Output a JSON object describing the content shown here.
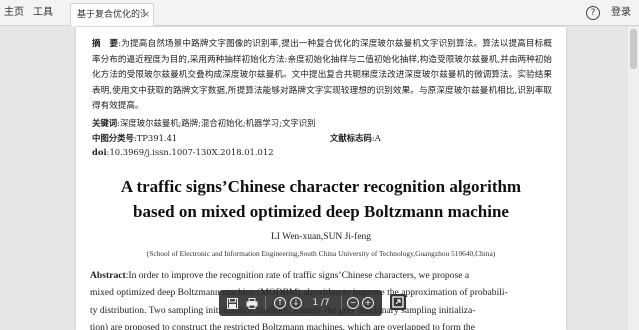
{
  "topbar": {
    "home": "主页",
    "tools": "工具",
    "doc_tab_title": "基于复合优化的深...",
    "tab_close": "×",
    "help": "?",
    "login": "登录"
  },
  "paper": {
    "abstract_cn_label": "摘　要",
    "abstract_cn_text": ":为提高自然场景中路牌文字图像的识别率,提出一种复合优化的深度玻尔兹曼机文字识别算法。算法以提高目标概率分布的逼近程度为目的,采用两种抽样初始化方法:亲度初始化抽样与二值初始化抽样,构造受限玻尔兹曼机,并由两种初始化方法的受限玻尔兹曼机交叠构成深度玻尔兹曼机。文中提出复合共轭梯度法改进深度玻尔兹曼机的微调算法。实验结果表明,使用文中获取的路牌文字数据,所提算法能够对路牌文字实现较理想的识别效果。与原深度玻尔兹曼机相比,识别率取得有效提高。",
    "keywords_label": "关键词",
    "keywords": ":深度玻尔兹曼机;路牌;混合初始化;机器学习;文字识别",
    "clc_label": "中图分类号",
    "clc": ":TP391.41",
    "doc_code_label": "文献标志码",
    "doc_code": ":A",
    "doi_label": "doi",
    "doi": ":10.3969/j.issn.1007-130X.2018.01.012",
    "title_line1": "A traffic signs’Chinese character recognition algorithm",
    "title_line2": "based on mixed optimized deep Boltzmann machine",
    "authors": "LI Wen-xuan,SUN Ji-feng",
    "affiliation": "(School of Electronic and Information Engineering,South China University of Technology,Guangzhou 510640,China)",
    "abstract_en_label": "Abstract",
    "abstract_en_l1": ":In order to improve the recognition rate of traffic signs’Chinese characters, we propose a",
    "abstract_en_l2": "mixed optimized deep Boltzmann machine (MODBM) algorithm to improve the approximation of probabili-",
    "abstract_en_l3": "ty distribution. Two sampling initialization methods, namely the grey and binary sampling initializa-",
    "abstract_en_l4": "tion) are proposed to construct the restricted Boltzmann machines, which are overlapped to form the"
  },
  "viewer_toolbar": {
    "save_icon": "save-icon",
    "print_icon": "print-icon",
    "page_indicator": "1 /7",
    "prev_symbol": "↑",
    "next_symbol": "↓",
    "zoom_out_symbol": "−",
    "zoom_in_symbol": "+"
  }
}
